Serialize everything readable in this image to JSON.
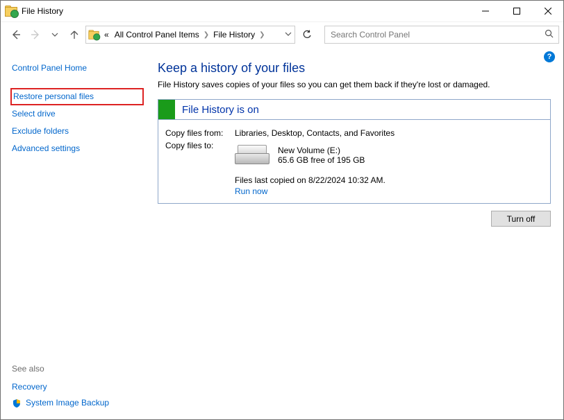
{
  "window": {
    "title": "File History"
  },
  "breadcrumb": {
    "prefix": "«",
    "items": [
      "All Control Panel Items",
      "File History"
    ]
  },
  "search": {
    "placeholder": "Search Control Panel"
  },
  "sidebar": {
    "home": "Control Panel Home",
    "links": {
      "restore": "Restore personal files",
      "select_drive": "Select drive",
      "exclude": "Exclude folders",
      "advanced": "Advanced settings"
    },
    "see_also": {
      "header": "See also",
      "recovery": "Recovery",
      "sys_backup": "System Image Backup"
    }
  },
  "main": {
    "heading": "Keep a history of your files",
    "description": "File History saves copies of your files so you can get them back if they're lost or damaged.",
    "status_label": "File History is on",
    "copy_from_label": "Copy files from:",
    "copy_from_value": "Libraries, Desktop, Contacts, and Favorites",
    "copy_to_label": "Copy files to:",
    "drive_name": "New Volume (E:)",
    "drive_free": "65.6 GB free of 195 GB",
    "last_copied": "Files last copied on 8/22/2024 10:32 AM.",
    "run_now": "Run now",
    "turn_off": "Turn off"
  },
  "help_icon_char": "?"
}
